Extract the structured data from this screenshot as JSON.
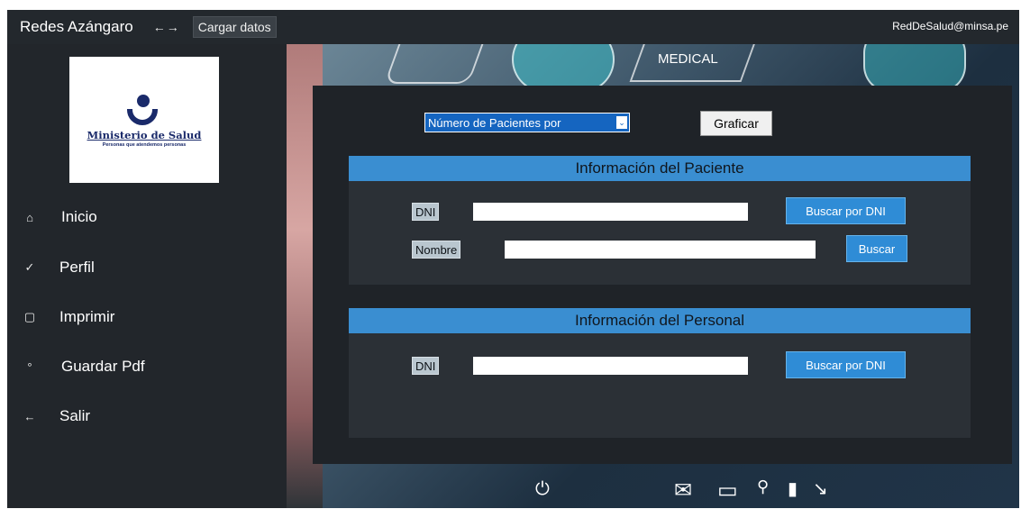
{
  "app": {
    "title": "Redes Azángaro",
    "nav_arrows": "←→",
    "load_button": "Cargar datos",
    "user_email": "RedDeSalud@minsa.pe"
  },
  "logo": {
    "name": "Ministerio de Salud",
    "tagline": "Personas que atendemos personas"
  },
  "menu": [
    {
      "label": "Inicio",
      "icon": "house-icon"
    },
    {
      "label": "Perfil",
      "icon": "profile-icon"
    },
    {
      "label": "Imprimir",
      "icon": "print-icon"
    },
    {
      "label": "Guardar Pdf",
      "icon": "save-pdf-icon"
    },
    {
      "label": "Salir",
      "icon": "exit-arrow-icon"
    }
  ],
  "background": {
    "banner_text": "MEDICAL"
  },
  "chart_controls": {
    "select_value": "Número de Pacientes por",
    "graph_button": "Graficar"
  },
  "patient_section": {
    "title": "Información del Paciente",
    "dni_label": "DNI",
    "dni_value": "",
    "search_dni_button": "Buscar por DNI",
    "name_label": "Nombre",
    "name_value": "",
    "search_button": "Buscar"
  },
  "staff_section": {
    "title": "Información del Personal",
    "dni_label": "DNI",
    "dni_value": "",
    "search_dni_button": "Buscar por DNI"
  },
  "colors": {
    "accent": "#3a8ed1",
    "sidebar": "#22262b"
  }
}
